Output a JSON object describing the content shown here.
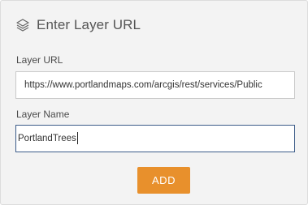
{
  "header": {
    "icon": "layers-icon",
    "title": "Enter Layer URL"
  },
  "form": {
    "url_label": "Layer URL",
    "url_value": "https://www.portlandmaps.com/arcgis/rest/services/Public",
    "name_label": "Layer Name",
    "name_value": "PortlandTrees"
  },
  "actions": {
    "add_label": "ADD"
  },
  "colors": {
    "accent": "#e8902c",
    "focus_border": "#3b5b88",
    "panel_bg": "#f3f3f3"
  }
}
